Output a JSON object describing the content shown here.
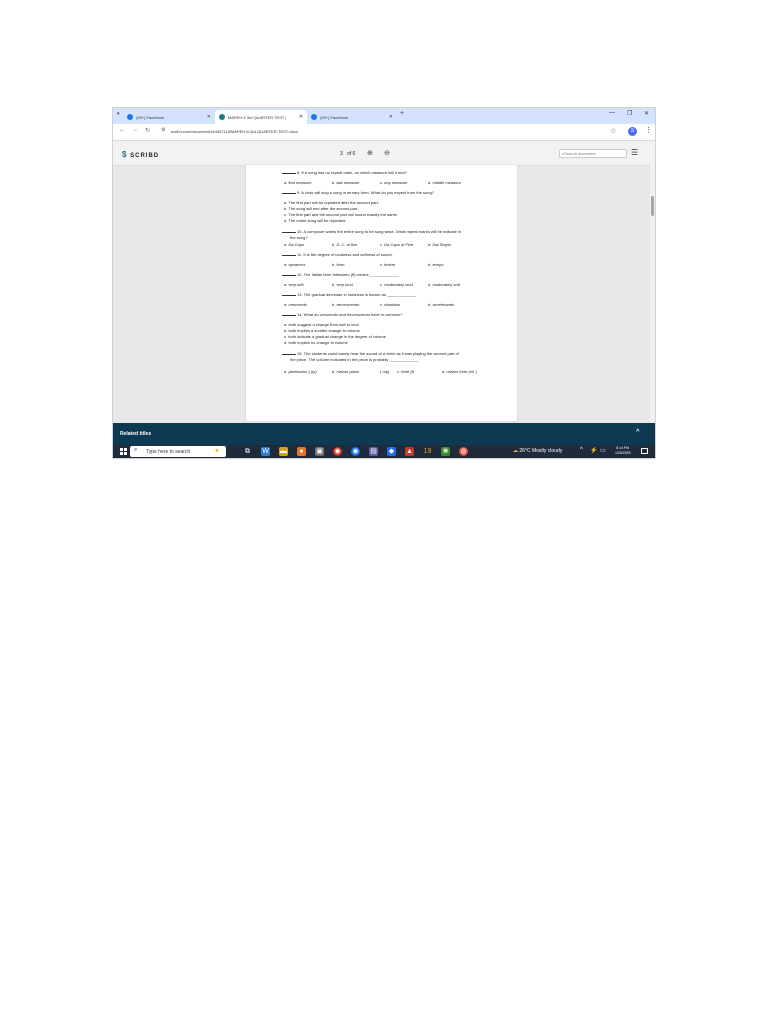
{
  "browser": {
    "tabs": [
      {
        "label": "(20+) Facebook",
        "icon": "facebook-icon"
      },
      {
        "label": "MAPEH 8 3rd QUARTER TEST |",
        "icon": "scribd-icon"
      },
      {
        "label": "(20+) Facebook",
        "icon": "facebook-icon"
      }
    ],
    "new_tab": "+",
    "url": "scribd.com/document/444457118/MAPEH-8-3rd-QUARTER-TEST-docx",
    "profile_initial": "S"
  },
  "scribd": {
    "logo": "SCRIBD",
    "page_current": "3",
    "page_total": "of 6",
    "search_placeholder": "Search document"
  },
  "questions": [
    {
      "blank": "_____",
      "text": "8. If a song has no repeat mark, on which measure will it end?",
      "options": [
        "a. first measure",
        "b. last measure",
        "c. any measure",
        "d. middle measure"
      ]
    },
    {
      "blank": "_____",
      "text": "9. A choir will sing a song in ternary form. What do you expect from the song?",
      "options": [
        "a. The first part will be repeated after the second part.",
        "b. The song will end after the second part.",
        "c. The first part and the second part will sound exactly the same.",
        "d. The entire song will be repeated."
      ]
    },
    {
      "blank": "_____",
      "text": "10. A composer wants the entire song to be sung twice. What repeat marks will he indicate in",
      "text2": "the song?",
      "options": [
        "a. Da Capo",
        "b. D. C. al fine",
        "c. Da Capo al Fine",
        "d. Dal Segno"
      ]
    },
    {
      "blank": "_____",
      "text": "11. It is the degree of loudness and softness of sound.",
      "options": [
        "a. dynamics",
        "b. form",
        "c. timbre",
        "d. tempo"
      ]
    },
    {
      "blank": "_____",
      "text": "12. The Italian term fortissimo (ff) means _____________",
      "options": [
        "a. very soft",
        "b. very loud",
        "c. moderately loud",
        "d. moderately soft"
      ]
    },
    {
      "blank": "_____",
      "text": "13. The gradual decrease in loudness is known as _____________",
      "options": [
        "a. crescendo",
        "b. decrescendo",
        "c. ritardano",
        "d. accelerando"
      ]
    },
    {
      "blank": "_____",
      "text": "14. What do crescendo and decrescendo have in common?",
      "options": [
        "a. both suggest a change from soft to loud",
        "b. both implies a sudden change in volume",
        "c. both indicate a gradual change in the degree of volume",
        "d. both implies no change in volume"
      ]
    },
    {
      "blank": "_____",
      "text": "15. The students could barely hear the sound of a violin as it was playing the second part of",
      "text2": "the piece. The volume indicated in the piece is probably _____________",
      "options": [
        "a. pianissimo ( pp)",
        "b. mezzo piano",
        "( mp)",
        "c. forte (f)",
        "d. mezzo forte (mf )"
      ]
    }
  ],
  "related": {
    "label": "Related titles"
  },
  "taskbar": {
    "search_placeholder": "Type here to search",
    "weather": "26°C  Mostly cloudy",
    "time": "8:14 PM",
    "date": "1/25/2025"
  }
}
